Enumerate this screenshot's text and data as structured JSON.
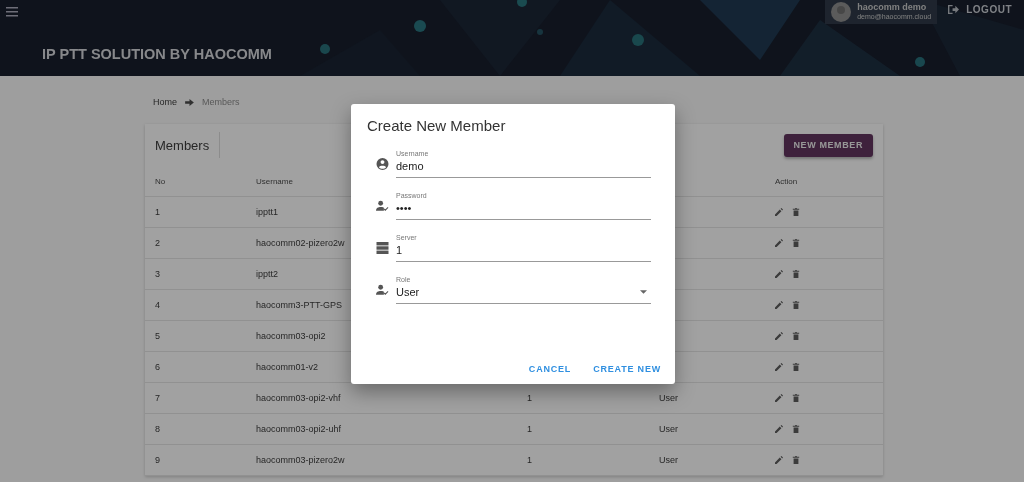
{
  "header": {
    "title": "IP PTT SOLUTION BY HAOCOMM",
    "user": {
      "name": "haocomm demo",
      "email": "demo@haocomm.cloud"
    },
    "logout": "LOGOUT"
  },
  "breadcrumb": [
    {
      "label": "Home",
      "active": false
    },
    {
      "label": "Members",
      "active": true
    }
  ],
  "members": {
    "title": "Members",
    "new_button": "NEW MEMBER",
    "columns": [
      "No",
      "Username",
      "Action"
    ],
    "rows": [
      {
        "no": "1",
        "username": "ipptt1"
      },
      {
        "no": "2",
        "username": "haocomm02-pizero2w"
      },
      {
        "no": "3",
        "username": "ipptt2"
      },
      {
        "no": "4",
        "username": "haocomm3-PTT-GPS"
      },
      {
        "no": "5",
        "username": "haocomm03-opi2"
      },
      {
        "no": "6",
        "username": "haocomm01-v2"
      },
      {
        "no": "7",
        "username": "haocomm03-opi2-vhf",
        "server": "1",
        "role": "User"
      },
      {
        "no": "8",
        "username": "haocomm03-opi2-uhf",
        "server": "1",
        "role": "User"
      },
      {
        "no": "9",
        "username": "haocomm03-pizero2w",
        "server": "1",
        "role": "User"
      }
    ]
  },
  "dialog": {
    "title": "Create New Member",
    "fields": [
      {
        "kind": "text",
        "label": "Username",
        "value": "demo"
      },
      {
        "kind": "text",
        "label": "Password",
        "value": "••••"
      },
      {
        "kind": "text",
        "label": "Server",
        "value": "1"
      },
      {
        "kind": "select",
        "label": "Role",
        "value": "User"
      }
    ],
    "buttons": [
      "CANCEL",
      "CREATE NEW"
    ]
  }
}
